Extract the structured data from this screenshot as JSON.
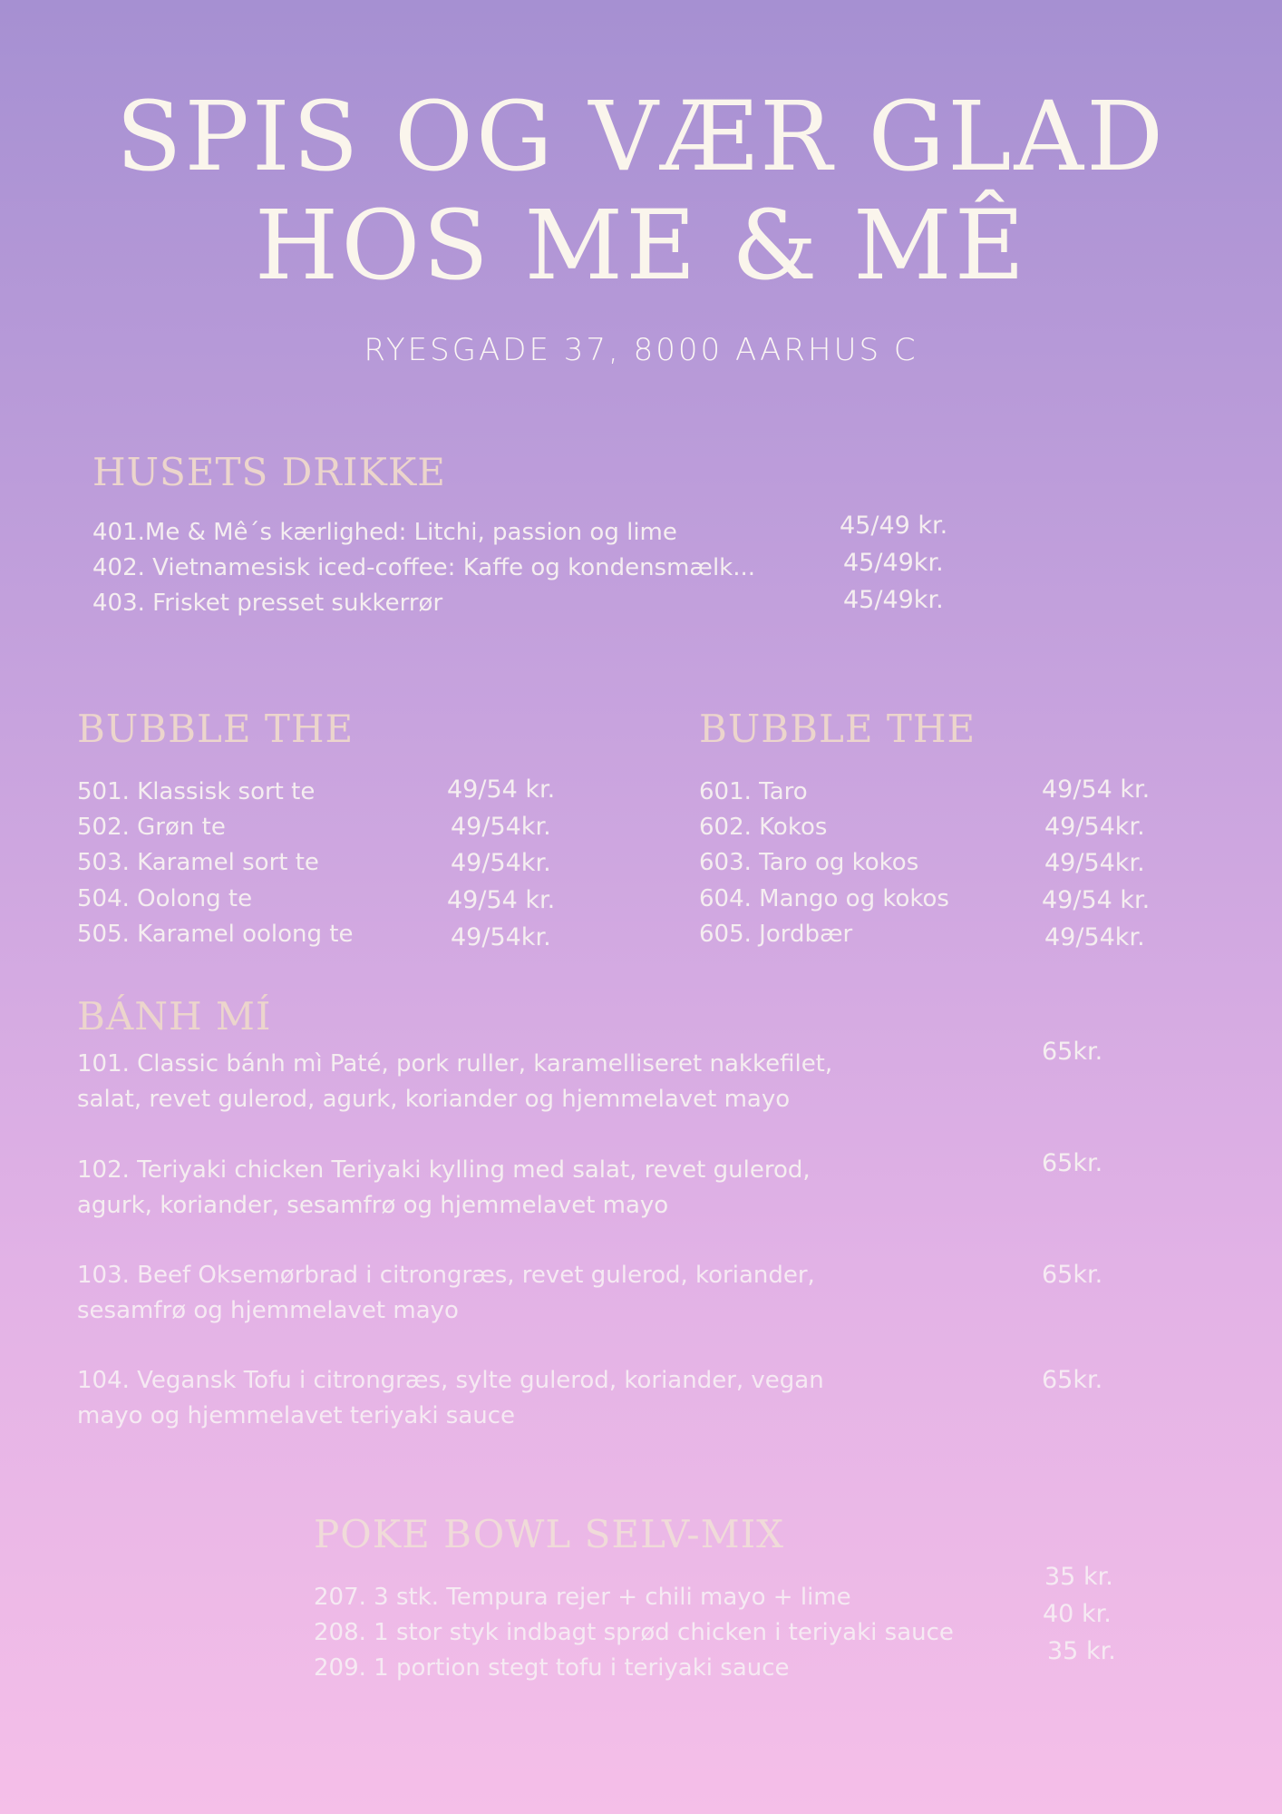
{
  "header": {
    "title_line1": "SPIS OG VÆR GLAD",
    "title_line2": "HOS ME & MÊ",
    "address": "RYESGADE 37, 8000 AARHUS C"
  },
  "husets_drikke": {
    "heading": "HUSETS DRIKKE",
    "items": [
      {
        "name": "401.Me & Mê´s kærlighed: Litchi, passion og lime",
        "price": "45/49 kr."
      },
      {
        "name": "402. Vietnamesisk iced-coffee: Kaffe og kondensmælk...",
        "price": "45/49kr."
      },
      {
        "name": "403. Frisket presset sukkerrør",
        "price": "45/49kr."
      }
    ]
  },
  "bubble_the_left": {
    "heading": "BUBBLE THE",
    "items": [
      {
        "name": "501. Klassisk sort te",
        "price": "49/54 kr."
      },
      {
        "name": "502. Grøn te",
        "price": "49/54kr."
      },
      {
        "name": "503. Karamel sort te",
        "price": "49/54kr."
      },
      {
        "name": "504. Oolong te",
        "price": "49/54 kr."
      },
      {
        "name": "505. Karamel oolong te",
        "price": "49/54kr."
      }
    ]
  },
  "bubble_the_right": {
    "heading": "BUBBLE THE",
    "items": [
      {
        "name": "601. Taro",
        "price": "49/54 kr."
      },
      {
        "name": "602. Kokos",
        "price": "49/54kr."
      },
      {
        "name": "603. Taro og kokos",
        "price": "49/54kr."
      },
      {
        "name": "604. Mango og kokos",
        "price": "49/54 kr."
      },
      {
        "name": "605. Jordbær",
        "price": "49/54kr."
      }
    ]
  },
  "banh_mi": {
    "heading": "BÁNH MÍ",
    "items": [
      {
        "line1": "101. Classic bánh mì Paté, pork ruller, karamelliseret nakkefilet,",
        "line2": "salat, revet gulerod, agurk, koriander og hjemmelavet mayo",
        "price": "65kr."
      },
      {
        "line1": "102. Teriyaki chicken Teriyaki kylling med salat, revet gulerod,",
        "line2": "agurk, koriander, sesamfrø og hjemmelavet mayo",
        "price": "65kr."
      },
      {
        "line1": "103. Beef Oksemørbrad i citrongræs, revet gulerod, koriander,",
        "line2": "sesamfrø og hjemmelavet mayo",
        "price": "65kr."
      },
      {
        "line1": "104. Vegansk Tofu i citrongræs, sylte gulerod, koriander, vegan",
        "line2": "mayo og hjemmelavet teriyaki sauce",
        "price": "65kr."
      }
    ]
  },
  "poke_bowl": {
    "heading": "POKE BOWL SELV-MIX",
    "items": [
      {
        "name": "207. 3 stk. Tempura rejer + chili mayo + lime",
        "price": "35 kr."
      },
      {
        "name": "208. 1 stor styk indbagt sprød chicken i teriyaki sauce",
        "price": "40 kr."
      },
      {
        "name": "209. 1 portion stegt tofu i teriyaki sauce",
        "price": "35 kr."
      }
    ]
  }
}
